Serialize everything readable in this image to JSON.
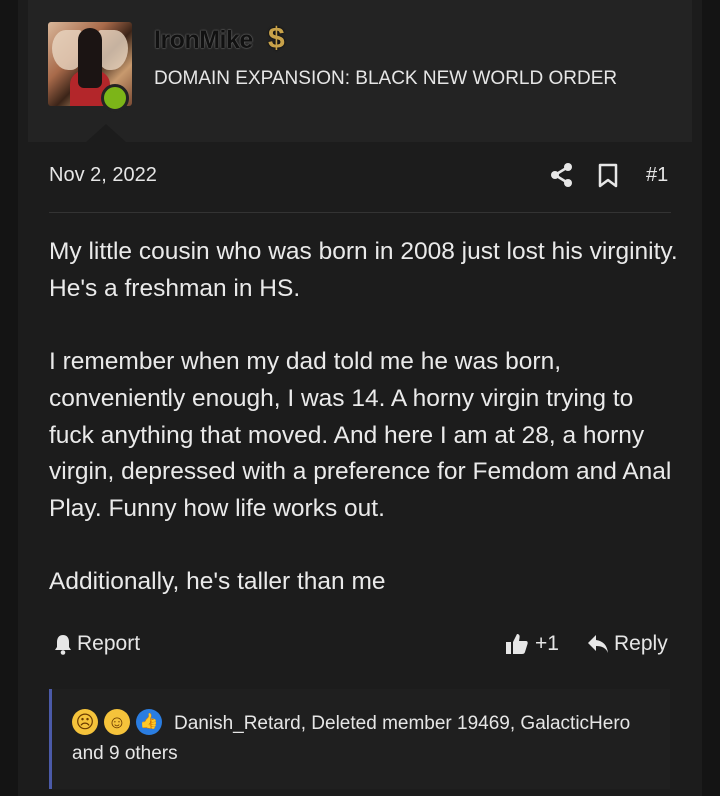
{
  "user": {
    "name": "IronMike",
    "title": "DOMAIN EXPANSION: BLACK NEW WORLD ORDER",
    "badge_icon": "dollar-icon",
    "status": "online"
  },
  "post": {
    "date": "Nov 2, 2022",
    "number": "#1",
    "paragraphs": [
      "My little cousin who was born in 2008 just lost his virginity. He's a freshman in HS.",
      "I remember when my dad told me he was born, conveniently enough, I was 14. A horny virgin trying to fuck anything that moved. And here I am at 28, a horny virgin, depressed with a preference for Femdom and Anal Play. Funny how life works out.",
      "Additionally, he's taller than me"
    ]
  },
  "actions": {
    "report_label": "Report",
    "like_count": "+1",
    "reply_label": "Reply"
  },
  "reactions": {
    "text": "Danish_Retard, Deleted member 19469, GalacticHero and 9 others",
    "icons": [
      "sad-face-icon",
      "crying-laughing-icon",
      "thumbs-up-icon"
    ]
  },
  "colors": {
    "accent": "#4b5aa8",
    "online": "#7cb518",
    "background": "#1c1c1c"
  }
}
